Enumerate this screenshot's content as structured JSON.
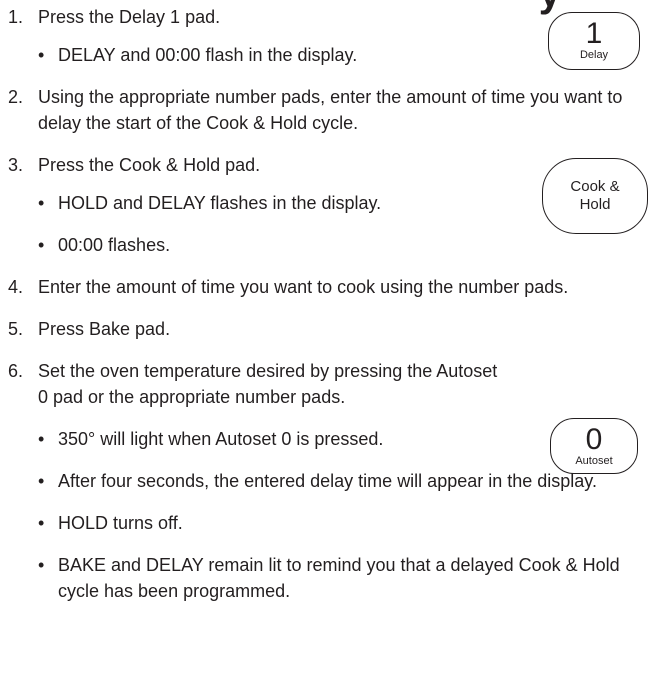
{
  "top_fragment": "y",
  "steps": [
    {
      "num": "1.",
      "text": "Press the Delay 1 pad.",
      "bullets": [
        "DELAY and 00:00 flash in the display."
      ]
    },
    {
      "num": "2.",
      "text": "Using the appropriate number pads, enter the amount of time you want to delay the start of the Cook & Hold cycle.",
      "bullets": []
    },
    {
      "num": "3.",
      "text": "Press the Cook & Hold pad.",
      "bullets": [
        "HOLD and DELAY flashes in the display.",
        "00:00 flashes."
      ]
    },
    {
      "num": "4.",
      "text": "Enter the amount of time you want to cook using the number pads.",
      "bullets": []
    },
    {
      "num": "5.",
      "text": "Press Bake pad.",
      "bullets": []
    },
    {
      "num": "6.",
      "text": "Set the oven temperature desired by pressing the Autoset 0 pad or the appropriate number pads.",
      "bullets": [
        "350° will light when Autoset 0 is pressed.",
        "After four seconds, the entered delay time will appear in the display.",
        "HOLD turns off.",
        "BAKE and DELAY remain lit to remind you that a delayed Cook & Hold cycle has been programmed."
      ]
    }
  ],
  "keys": {
    "delay": {
      "big": "1",
      "small": "Delay"
    },
    "cook_hold": {
      "line1": "Cook &",
      "line2": "Hold"
    },
    "autoset": {
      "big": "0",
      "small": "Autoset"
    }
  },
  "bullet_char": "•"
}
